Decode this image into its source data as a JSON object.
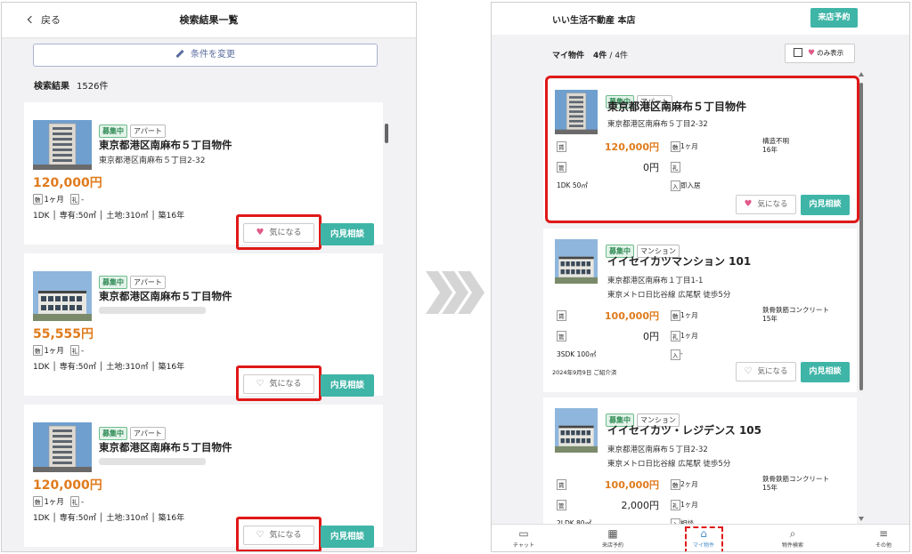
{
  "left": {
    "back_label": "戻る",
    "title": "検索結果一覧",
    "condition_button": "条件を変更",
    "result_label": "検索結果",
    "result_count": "1526件",
    "cards": [
      {
        "status": "募集中",
        "type": "アパート",
        "name": "東京都港区南麻布５丁目物件",
        "address": "東京都港区南麻布５丁目2-32",
        "address_blurred": false,
        "price": "120,000円",
        "fee_chip1": "敷",
        "fee_val1": "1ヶ月",
        "fee_chip2": "礼",
        "fee_val2": "-",
        "spec": "1DK │ 専有:50㎡ │ 土地:310㎡ │ 築16年",
        "favorite_label": "気になる",
        "favorite_on": true,
        "viewing_label": "内見相談"
      },
      {
        "status": "募集中",
        "type": "アパート",
        "name": "東京都港区南麻布５丁目物件",
        "address": "",
        "address_blurred": true,
        "price": "55,555円",
        "fee_chip1": "敷",
        "fee_val1": "1ヶ月",
        "fee_chip2": "礼",
        "fee_val2": "-",
        "spec": "1DK │ 専有:50㎡ │ 土地:310㎡ │ 築16年",
        "favorite_label": "気になる",
        "favorite_on": false,
        "viewing_label": "内見相談"
      },
      {
        "status": "募集中",
        "type": "アパート",
        "name": "東京都港区南麻布５丁目物件",
        "address": "",
        "address_blurred": true,
        "price": "120,000円",
        "fee_chip1": "敷",
        "fee_val1": "1ヶ月",
        "fee_chip2": "礼",
        "fee_val2": "-",
        "spec": "1DK │ 専有:50㎡ │ 土地:310㎡ │ 築16年",
        "favorite_label": "気になる",
        "favorite_on": false,
        "viewing_label": "内見相談"
      }
    ]
  },
  "right": {
    "shop_name": "いい生活不動産 本店",
    "visit_button": "来店予約",
    "my_label": "マイ物件",
    "my_count": "4件",
    "my_total": "/ 4件",
    "only_label": "のみ表示",
    "cards": [
      {
        "status": "募集中",
        "type": "アパート",
        "name": "東京都港区南麻布５丁目物件",
        "address1": "東京都港区南麻布５丁目2-32",
        "address2": "",
        "rent_chip": "賃",
        "rent": "120,000円",
        "mgmt_chip": "管",
        "mgmt": "0円",
        "deposit_chip": "敷",
        "deposit": "1ヶ月",
        "key_chip": "礼",
        "key": "",
        "structure": "構造不明",
        "age": "16年",
        "layout": "1DK 50㎡",
        "move_chip": "入",
        "move": "即入居",
        "date": "",
        "favorite_label": "気になる",
        "favorite_on": true,
        "viewing_label": "内見相談"
      },
      {
        "status": "募集中",
        "type": "マンション",
        "name": "イイセイカツマンション 101",
        "address1": "東京都港区南麻布１丁目1-1",
        "address2": "東京メトロ日比谷線 広尾駅 徒歩5分",
        "rent_chip": "賃",
        "rent": "100,000円",
        "mgmt_chip": "管",
        "mgmt": "0円",
        "deposit_chip": "敷",
        "deposit": "1ヶ月",
        "key_chip": "礼",
        "key": "1ヶ月",
        "structure": "鉄骨鉄筋コンクリート",
        "age": "15年",
        "layout": "3SDK 100㎡",
        "move_chip": "入",
        "move": "-",
        "date": "2024年9月9日 ご紹介済",
        "favorite_label": "気になる",
        "favorite_on": false,
        "viewing_label": "内見相談"
      },
      {
        "status": "募集中",
        "type": "マンション",
        "name": "イイセイカツ・レジデンス 105",
        "address1": "東京都港区南麻布５丁目2-32",
        "address2": "東京メトロ日比谷線 広尾駅 徒歩5分",
        "rent_chip": "賃",
        "rent": "100,000円",
        "mgmt_chip": "管",
        "mgmt": "2,000円",
        "deposit_chip": "敷",
        "deposit": "2ヶ月",
        "key_chip": "礼",
        "key": "1ヶ月",
        "structure": "鉄骨鉄筋コンクリート",
        "age": "15年",
        "layout": "2LDK 80㎡",
        "move_chip": "入",
        "move": "相談",
        "date": "",
        "favorite_label": "",
        "favorite_on": false,
        "viewing_label": ""
      }
    ],
    "nav": [
      {
        "label": "チャット",
        "icon": "chat-icon"
      },
      {
        "label": "来店予約",
        "icon": "calendar-icon"
      },
      {
        "label": "マイ物件",
        "icon": "my-property-icon"
      },
      {
        "label": "物件検索",
        "icon": "search-icon"
      },
      {
        "label": "その他",
        "icon": "menu-icon"
      }
    ]
  },
  "colors": {
    "accent_teal": "#3fb5a7",
    "price_orange": "#e07b1c",
    "highlight_red": "#e01818",
    "heart_pink": "#e05a8a",
    "nav_active_blue": "#4a8fc9"
  }
}
